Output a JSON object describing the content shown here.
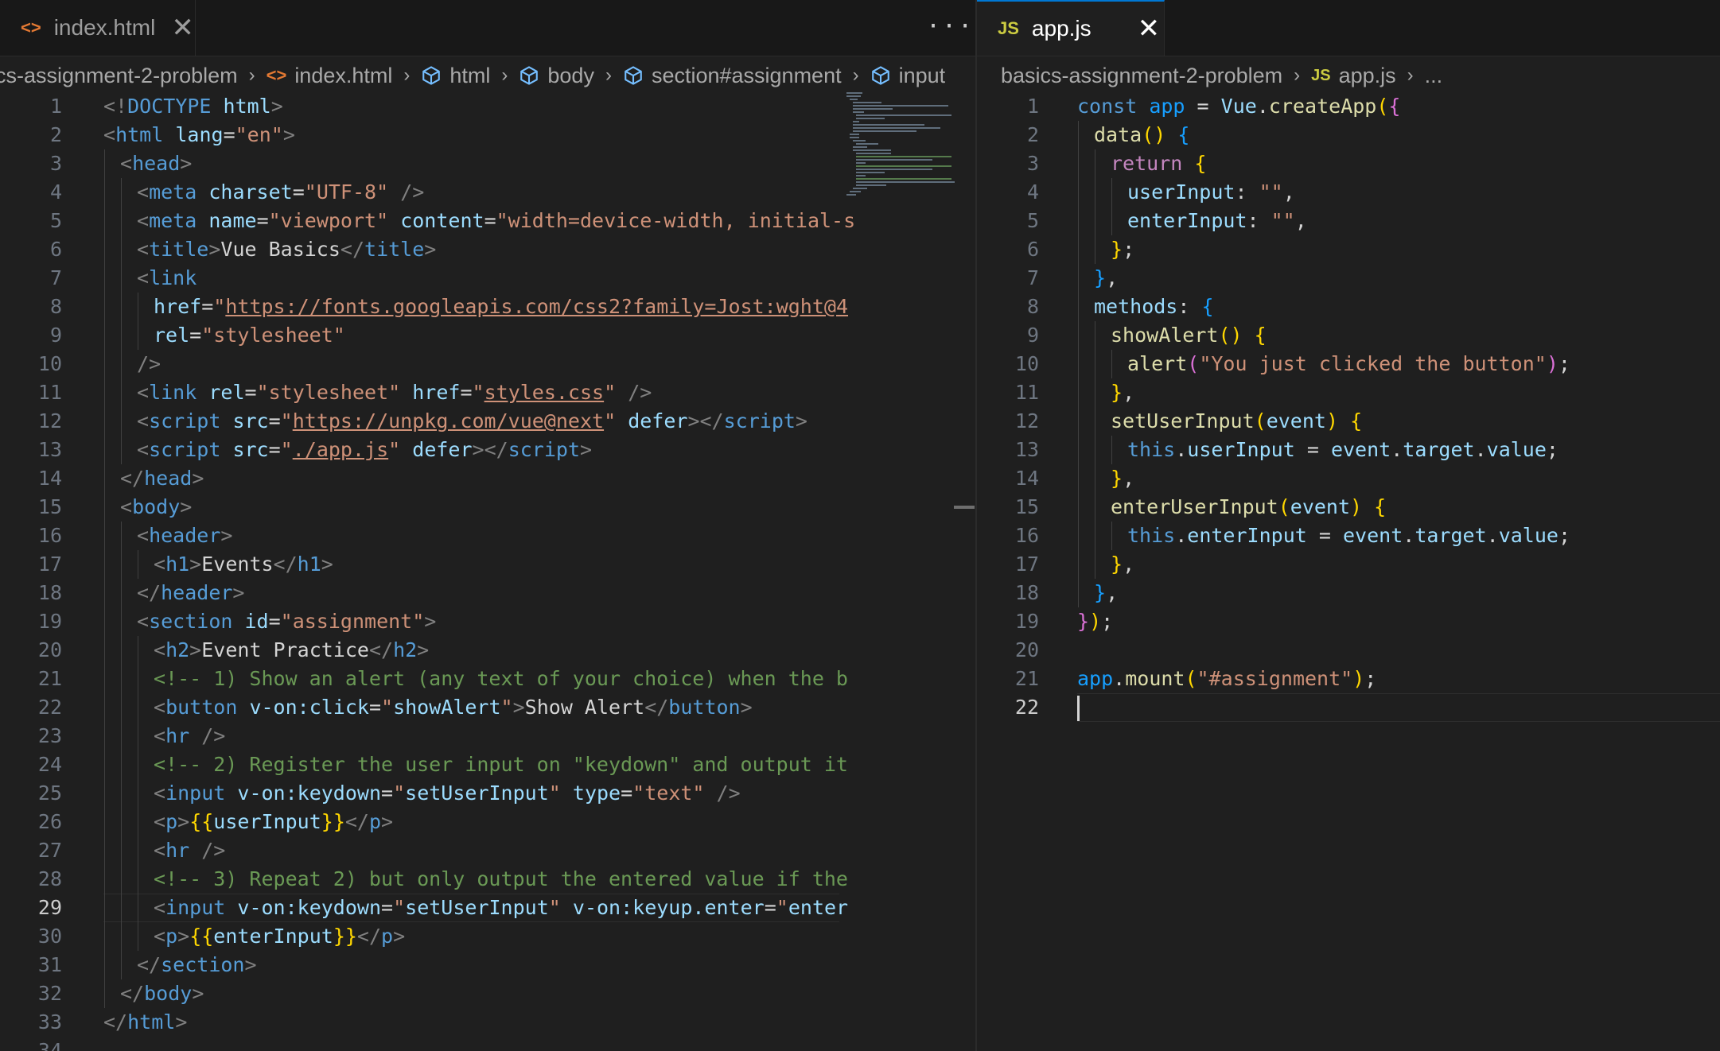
{
  "left_editor": {
    "tab": {
      "icon_text": "<>",
      "label": "index.html",
      "close": "✕"
    },
    "more_actions": "···",
    "breadcrumb": [
      {
        "label": "cs-assignment-2-problem",
        "icon": ""
      },
      {
        "label": "index.html",
        "icon": "html-file-icon"
      },
      {
        "label": "html",
        "icon": "symbol-element-icon"
      },
      {
        "label": "body",
        "icon": "symbol-element-icon"
      },
      {
        "label": "section#assignment",
        "icon": "symbol-element-icon"
      },
      {
        "label": "input",
        "icon": "symbol-element-icon"
      }
    ],
    "current_line": 29,
    "lines": [
      {
        "n": "1",
        "indent": 0,
        "html": "<span class=\"p\">&lt;!</span><span class=\"t\">DOCTYPE</span> <span class=\"a\">html</span><span class=\"p\">&gt;</span>"
      },
      {
        "n": "2",
        "indent": 0,
        "html": "<span class=\"p\">&lt;</span><span class=\"t\">html</span> <span class=\"a\">lang</span><span class=\"x\">=</span><span class=\"s\">\"en\"</span><span class=\"p\">&gt;</span>"
      },
      {
        "n": "3",
        "indent": 1,
        "html": "<span class=\"p\">&lt;</span><span class=\"t\">head</span><span class=\"p\">&gt;</span>"
      },
      {
        "n": "4",
        "indent": 2,
        "html": "<span class=\"p\">&lt;</span><span class=\"t\">meta</span> <span class=\"a\">charset</span><span class=\"x\">=</span><span class=\"s\">\"UTF-8\"</span> <span class=\"p\">/&gt;</span>"
      },
      {
        "n": "5",
        "indent": 2,
        "html": "<span class=\"p\">&lt;</span><span class=\"t\">meta</span> <span class=\"a\">name</span><span class=\"x\">=</span><span class=\"s\">\"viewport\"</span> <span class=\"a\">content</span><span class=\"x\">=</span><span class=\"s\">\"width=device-width, initial-s</span>"
      },
      {
        "n": "6",
        "indent": 2,
        "html": "<span class=\"p\">&lt;</span><span class=\"t\">title</span><span class=\"p\">&gt;</span><span class=\"x\">Vue Basics</span><span class=\"p\">&lt;/</span><span class=\"t\">title</span><span class=\"p\">&gt;</span>"
      },
      {
        "n": "7",
        "indent": 2,
        "html": "<span class=\"p\">&lt;</span><span class=\"t\">link</span>"
      },
      {
        "n": "8",
        "indent": 3,
        "html": "<span class=\"a\">href</span><span class=\"x\">=</span><span class=\"s\">\"<span class=\"u\">https://fonts.googleapis.com/css2?family=Jost:wght@4</span></span>"
      },
      {
        "n": "9",
        "indent": 3,
        "html": "<span class=\"a\">rel</span><span class=\"x\">=</span><span class=\"s\">\"stylesheet\"</span>"
      },
      {
        "n": "10",
        "indent": 2,
        "html": "<span class=\"p\">/&gt;</span>"
      },
      {
        "n": "11",
        "indent": 2,
        "html": "<span class=\"p\">&lt;</span><span class=\"t\">link</span> <span class=\"a\">rel</span><span class=\"x\">=</span><span class=\"s\">\"stylesheet\"</span> <span class=\"a\">href</span><span class=\"x\">=</span><span class=\"s\">\"<span class=\"u\">styles.css</span>\"</span> <span class=\"p\">/&gt;</span>"
      },
      {
        "n": "12",
        "indent": 2,
        "html": "<span class=\"p\">&lt;</span><span class=\"t\">script</span> <span class=\"a\">src</span><span class=\"x\">=</span><span class=\"s\">\"<span class=\"u\">https://unpkg.com/vue@next</span>\"</span> <span class=\"a\">defer</span><span class=\"p\">&gt;&lt;/</span><span class=\"t\">script</span><span class=\"p\">&gt;</span>"
      },
      {
        "n": "13",
        "indent": 2,
        "html": "<span class=\"p\">&lt;</span><span class=\"t\">script</span> <span class=\"a\">src</span><span class=\"x\">=</span><span class=\"s\">\"<span class=\"u\">./app.js</span>\"</span> <span class=\"a\">defer</span><span class=\"p\">&gt;&lt;/</span><span class=\"t\">script</span><span class=\"p\">&gt;</span>"
      },
      {
        "n": "14",
        "indent": 1,
        "html": "<span class=\"p\">&lt;/</span><span class=\"t\">head</span><span class=\"p\">&gt;</span>"
      },
      {
        "n": "15",
        "indent": 1,
        "html": "<span class=\"p\">&lt;</span><span class=\"t\">body</span><span class=\"p\">&gt;</span>"
      },
      {
        "n": "16",
        "indent": 2,
        "html": "<span class=\"p\">&lt;</span><span class=\"t\">header</span><span class=\"p\">&gt;</span>"
      },
      {
        "n": "17",
        "indent": 3,
        "html": "<span class=\"p\">&lt;</span><span class=\"t\">h1</span><span class=\"p\">&gt;</span><span class=\"x\">Events</span><span class=\"p\">&lt;/</span><span class=\"t\">h1</span><span class=\"p\">&gt;</span>"
      },
      {
        "n": "18",
        "indent": 2,
        "html": "<span class=\"p\">&lt;/</span><span class=\"t\">header</span><span class=\"p\">&gt;</span>"
      },
      {
        "n": "19",
        "indent": 2,
        "html": "<span class=\"p\">&lt;</span><span class=\"t\">section</span> <span class=\"a\">id</span><span class=\"x\">=</span><span class=\"s\">\"assignment\"</span><span class=\"p\">&gt;</span>"
      },
      {
        "n": "20",
        "indent": 3,
        "html": "<span class=\"p\">&lt;</span><span class=\"t\">h2</span><span class=\"p\">&gt;</span><span class=\"x\">Event Practice</span><span class=\"p\">&lt;/</span><span class=\"t\">h2</span><span class=\"p\">&gt;</span>"
      },
      {
        "n": "21",
        "indent": 3,
        "html": "<span class=\"c\">&lt;!-- 1) Show an alert (any text of your choice) when the b</span>"
      },
      {
        "n": "22",
        "indent": 3,
        "html": "<span class=\"p\">&lt;</span><span class=\"t\">button</span> <span class=\"a\">v-on:click</span><span class=\"x\">=</span><span class=\"s\">\"</span><span class=\"v\">showAlert</span><span class=\"s\">\"</span><span class=\"p\">&gt;</span><span class=\"x\">Show Alert</span><span class=\"p\">&lt;/</span><span class=\"t\">button</span><span class=\"p\">&gt;</span>"
      },
      {
        "n": "23",
        "indent": 3,
        "html": "<span class=\"p\">&lt;</span><span class=\"t\">hr</span> <span class=\"p\">/&gt;</span>"
      },
      {
        "n": "24",
        "indent": 3,
        "html": "<span class=\"c\">&lt;!-- 2) Register the user input on \"keydown\" and output it</span>"
      },
      {
        "n": "25",
        "indent": 3,
        "html": "<span class=\"p\">&lt;</span><span class=\"t\">input</span> <span class=\"a\">v-on:keydown</span><span class=\"x\">=</span><span class=\"s\">\"</span><span class=\"v\">setUserInput</span><span class=\"s\">\"</span> <span class=\"a\">type</span><span class=\"x\">=</span><span class=\"s\">\"text\"</span> <span class=\"p\">/&gt;</span>"
      },
      {
        "n": "26",
        "indent": 3,
        "html": "<span class=\"p\">&lt;</span><span class=\"t\">p</span><span class=\"p\">&gt;</span><span class=\"y\">{{</span><span class=\"v\">userInput</span><span class=\"y\">}}</span><span class=\"p\">&lt;/</span><span class=\"t\">p</span><span class=\"p\">&gt;</span>"
      },
      {
        "n": "27",
        "indent": 3,
        "html": "<span class=\"p\">&lt;</span><span class=\"t\">hr</span> <span class=\"p\">/&gt;</span>"
      },
      {
        "n": "28",
        "indent": 3,
        "html": "<span class=\"c\">&lt;!-- 3) Repeat 2) but only output the entered value if the</span>"
      },
      {
        "n": "29",
        "indent": 3,
        "html": "<span class=\"p\">&lt;</span><span class=\"t\">input</span> <span class=\"a\">v-on:keydown</span><span class=\"x\">=</span><span class=\"s\">\"</span><span class=\"v\">setUserInput</span><span class=\"s\">\"</span> <span class=\"a\">v-on:keyup.enter</span><span class=\"x\">=</span><span class=\"s\">\"</span><span class=\"v\">enter</span>"
      },
      {
        "n": "30",
        "indent": 3,
        "html": "<span class=\"p\">&lt;</span><span class=\"t\">p</span><span class=\"p\">&gt;</span><span class=\"y\">{{</span><span class=\"v\">enterInput</span><span class=\"y\">}}</span><span class=\"p\">&lt;/</span><span class=\"t\">p</span><span class=\"p\">&gt;</span>"
      },
      {
        "n": "31",
        "indent": 2,
        "html": "<span class=\"p\">&lt;/</span><span class=\"t\">section</span><span class=\"p\">&gt;</span>"
      },
      {
        "n": "32",
        "indent": 1,
        "html": "<span class=\"p\">&lt;/</span><span class=\"t\">body</span><span class=\"p\">&gt;</span>"
      },
      {
        "n": "33",
        "indent": 0,
        "html": "<span class=\"p\">&lt;/</span><span class=\"t\">html</span><span class=\"p\">&gt;</span>"
      },
      {
        "n": "34",
        "indent": 0,
        "html": ""
      }
    ]
  },
  "right_editor": {
    "tab": {
      "icon_text": "JS",
      "label": "app.js",
      "close": "✕"
    },
    "breadcrumb": [
      {
        "label": "basics-assignment-2-problem",
        "icon": ""
      },
      {
        "label": "app.js",
        "icon": "js-file-icon"
      },
      {
        "label": "...",
        "icon": ""
      }
    ],
    "current_line": 22,
    "lines": [
      {
        "n": "1",
        "indent": 0,
        "html": "<span class=\"k\">const</span> <span class=\"b\">app</span> <span class=\"x\">=</span> <span class=\"v\">Vue</span><span class=\"x\">.</span><span class=\"f\">createApp</span><span class=\"y\">(</span><span class=\"m\">{</span>"
      },
      {
        "n": "2",
        "indent": 1,
        "html": "<span class=\"f\">data</span><span class=\"y\">()</span> <span class=\"b\">{</span>"
      },
      {
        "n": "3",
        "indent": 2,
        "html": "<span class=\"kw\">return</span> <span class=\"y\">{</span>"
      },
      {
        "n": "4",
        "indent": 3,
        "html": "<span class=\"v\">userInput</span><span class=\"x\">: </span><span class=\"s\">\"\"</span><span class=\"x\">,</span>"
      },
      {
        "n": "5",
        "indent": 3,
        "html": "<span class=\"v\">enterInput</span><span class=\"x\">: </span><span class=\"s\">\"\"</span><span class=\"x\">,</span>"
      },
      {
        "n": "6",
        "indent": 2,
        "html": "<span class=\"y\">}</span><span class=\"x\">;</span>"
      },
      {
        "n": "7",
        "indent": 1,
        "html": "<span class=\"b\">}</span><span class=\"x\">,</span>"
      },
      {
        "n": "8",
        "indent": 1,
        "html": "<span class=\"v\">methods</span><span class=\"x\">: </span><span class=\"b\">{</span>"
      },
      {
        "n": "9",
        "indent": 2,
        "html": "<span class=\"f\">showAlert</span><span class=\"y\">()</span> <span class=\"y\">{</span>"
      },
      {
        "n": "10",
        "indent": 3,
        "html": "<span class=\"f\">alert</span><span class=\"m\">(</span><span class=\"s\">\"You just clicked the button\"</span><span class=\"m\">)</span><span class=\"x\">;</span>"
      },
      {
        "n": "11",
        "indent": 2,
        "html": "<span class=\"y\">}</span><span class=\"x\">,</span>"
      },
      {
        "n": "12",
        "indent": 2,
        "html": "<span class=\"f\">setUserInput</span><span class=\"y\">(</span><span class=\"v\">event</span><span class=\"y\">)</span> <span class=\"y\">{</span>"
      },
      {
        "n": "13",
        "indent": 3,
        "html": "<span class=\"k\">this</span><span class=\"x\">.</span><span class=\"v\">userInput</span> <span class=\"x\">=</span> <span class=\"v\">event</span><span class=\"x\">.</span><span class=\"v\">target</span><span class=\"x\">.</span><span class=\"v\">value</span><span class=\"x\">;</span>"
      },
      {
        "n": "14",
        "indent": 2,
        "html": "<span class=\"y\">}</span><span class=\"x\">,</span>"
      },
      {
        "n": "15",
        "indent": 2,
        "html": "<span class=\"f\">enterUserInput</span><span class=\"y\">(</span><span class=\"v\">event</span><span class=\"y\">)</span> <span class=\"y\">{</span>"
      },
      {
        "n": "16",
        "indent": 3,
        "html": "<span class=\"k\">this</span><span class=\"x\">.</span><span class=\"v\">enterInput</span> <span class=\"x\">=</span> <span class=\"v\">event</span><span class=\"x\">.</span><span class=\"v\">target</span><span class=\"x\">.</span><span class=\"v\">value</span><span class=\"x\">;</span>"
      },
      {
        "n": "17",
        "indent": 2,
        "html": "<span class=\"y\">}</span><span class=\"x\">,</span>"
      },
      {
        "n": "18",
        "indent": 1,
        "html": "<span class=\"b\">}</span><span class=\"x\">,</span>"
      },
      {
        "n": "19",
        "indent": 0,
        "html": "<span class=\"m\">}</span><span class=\"y\">)</span><span class=\"x\">;</span>"
      },
      {
        "n": "20",
        "indent": 0,
        "html": ""
      },
      {
        "n": "21",
        "indent": 0,
        "html": "<span class=\"b\">app</span><span class=\"x\">.</span><span class=\"f\">mount</span><span class=\"y\">(</span><span class=\"s\">\"#assignment\"</span><span class=\"y\">)</span><span class=\"x\">;</span>"
      },
      {
        "n": "22",
        "indent": 0,
        "html": "<span class=\"cursor\"></span>"
      }
    ]
  },
  "colors": {
    "editor_bg": "#1f1f1f",
    "tab_active_accent": "#0078d4",
    "html_icon": "#e37933",
    "js_icon": "#cbcb41",
    "symbol_icon": "#75beff"
  }
}
